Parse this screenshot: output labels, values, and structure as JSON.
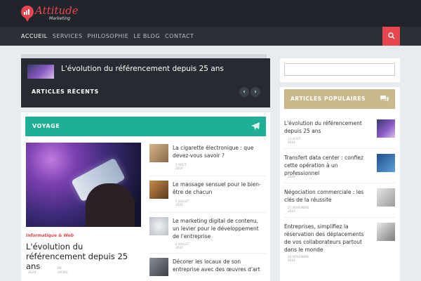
{
  "brand": {
    "name": "Attitude",
    "tagline": "Marketing"
  },
  "nav": {
    "items": [
      {
        "label": "ACCUEIL",
        "active": true
      },
      {
        "label": "SERVICES",
        "active": false
      },
      {
        "label": "PHILOSOPHIE",
        "active": false
      },
      {
        "label": "LE BLOG",
        "active": false
      },
      {
        "label": "CONTACT",
        "active": false
      }
    ],
    "search_icon": "search-icon"
  },
  "slider": {
    "title": "L'évolution du référencement depuis 25 ans",
    "section_label": "ARTICLES RÉCENTS",
    "prev": "‹",
    "next": "›"
  },
  "voyage": {
    "heading": "VOYAGE",
    "icon": "plane-icon",
    "featured": {
      "category": "Informatique & Web",
      "title": "L'évolution du référencement depuis 25 ans",
      "date_line1": "25 AOÛT",
      "date_line2": "2016",
      "views_line1": "66",
      "views_line2": "VIEWS"
    },
    "list": [
      {
        "title": "La cigarette électronique : que devez-vous savoir ?",
        "date_line1": "5 AOÛT",
        "date_line2": "2016"
      },
      {
        "title": "Le massage sensuel pour le bien-être de chacun",
        "date_line1": "5 JUILLET",
        "date_line2": "2016"
      },
      {
        "title": "Le marketing digital de contenu, un levier pour le développement de l'entreprise",
        "date_line1": "6 JUILLET",
        "date_line2": "2016"
      },
      {
        "title": "Décorer les locaux de son entreprise avec des œuvres d'art",
        "date_line1": "",
        "date_line2": ""
      }
    ]
  },
  "search": {
    "value": "",
    "placeholder": ""
  },
  "popular": {
    "heading": "ARTICLES POPULAIRES",
    "icon": "chat-icon",
    "items": [
      {
        "title": "L'évolution du référencement depuis 25 ans",
        "date_line1": "13 AOÛT",
        "date_line2": "2016"
      },
      {
        "title": "Transfert data center : confiez cette opération à un professionnel",
        "date_line1": "26 OCTOBRE",
        "date_line2": "2016"
      },
      {
        "title": "Négociation commerciale : les clés de la réussite",
        "date_line1": "25 NOVEMBRE",
        "date_line2": "2016"
      },
      {
        "title": "Entreprises, simplifiez la réservation des déplacements de vos collaborateurs partout dans le monde",
        "date_line1": "16 NOVEMBRE",
        "date_line2": "2016"
      }
    ]
  },
  "colors": {
    "accent": "#e8464e",
    "voyage": "#1fae96",
    "popular": "#c9b98d",
    "topbar": "#21252b"
  }
}
